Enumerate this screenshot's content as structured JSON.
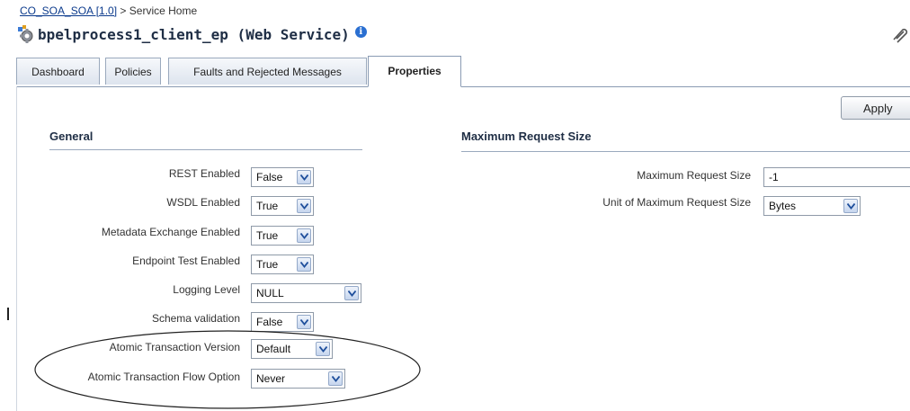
{
  "breadcrumb": {
    "link": "CO_SOA_SOA [1.0]",
    "separator": ">",
    "current": "Service Home"
  },
  "header": {
    "title": "bpelprocess1_client_ep (Web Service)",
    "info_icon": "info-icon"
  },
  "tabs": [
    {
      "label": "Dashboard",
      "active": false
    },
    {
      "label": "Policies",
      "active": false
    },
    {
      "label": "Faults and Rejected Messages",
      "active": false
    },
    {
      "label": "Properties",
      "active": true
    }
  ],
  "toolbar": {
    "apply_label": "Apply"
  },
  "general": {
    "title": "General",
    "fields": [
      {
        "label": "REST Enabled",
        "value": "False"
      },
      {
        "label": "WSDL Enabled",
        "value": "True"
      },
      {
        "label": "Metadata Exchange Enabled",
        "value": "True"
      },
      {
        "label": "Endpoint Test Enabled",
        "value": "True"
      },
      {
        "label": "Logging Level",
        "value": "NULL"
      },
      {
        "label": "Schema validation",
        "value": "False"
      },
      {
        "label": "Atomic Transaction Version",
        "value": "Default"
      },
      {
        "label": "Atomic Transaction Flow Option",
        "value": "Never"
      }
    ]
  },
  "max_request": {
    "title": "Maximum Request Size",
    "fields": [
      {
        "label": "Maximum Request Size",
        "value": "-1"
      },
      {
        "label": "Unit of Maximum Request Size",
        "value": "Bytes"
      }
    ]
  },
  "colors": {
    "accent": "#2a6fd1",
    "tab_border": "#8a9bb3",
    "title": "#1f2e45"
  }
}
